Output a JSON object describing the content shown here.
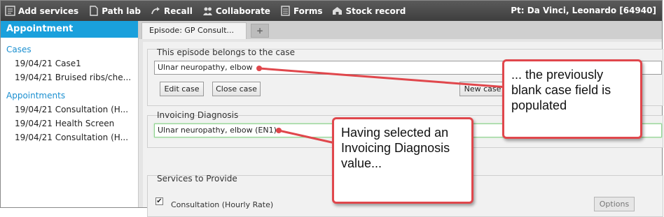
{
  "toolbar": {
    "items": [
      {
        "label": "Add services",
        "icon": "add-services-icon"
      },
      {
        "label": "Path lab",
        "icon": "document-icon"
      },
      {
        "label": "Recall",
        "icon": "recall-arrow-icon"
      },
      {
        "label": "Collaborate",
        "icon": "people-icon"
      },
      {
        "label": "Forms",
        "icon": "forms-icon"
      },
      {
        "label": "Stock record",
        "icon": "stock-icon"
      }
    ],
    "patient": "Pt: Da Vinci, Leonardo [64940]"
  },
  "sidebar": {
    "header": "Appointment",
    "cases_title": "Cases",
    "cases": [
      "19/04/21 Case1",
      "19/04/21 Bruised ribs/che..."
    ],
    "appointments_title": "Appointments",
    "appointments": [
      "19/04/21 Consultation (H...",
      "19/04/21 Health Screen",
      "19/04/21 Consultation (H..."
    ]
  },
  "tabs": {
    "active": "Episode: GP Consult...",
    "add": "+"
  },
  "episode_case": {
    "label": "This episode belongs to the case",
    "value": "Ulnar neuropathy, elbow",
    "edit_button": "Edit case",
    "close_button": "Close case",
    "new_button": "New case"
  },
  "invoicing": {
    "label": "Invoicing Diagnosis",
    "value": "Ulnar neuropathy, elbow (EN1)"
  },
  "services": {
    "label": "Services to Provide",
    "item": "Consultation (Hourly Rate)",
    "checked": true,
    "check_mark": "✔",
    "options_button": "Options"
  },
  "callouts": {
    "top": "... the previously blank case field is populated",
    "bottom": "Having selected an Invoicing Diagnosis value..."
  },
  "colors": {
    "toolbar": "#4a4a4a",
    "sidebar_header": "#1aa0dc",
    "link": "#1a8fd0",
    "callout_border": "#e0474c"
  }
}
